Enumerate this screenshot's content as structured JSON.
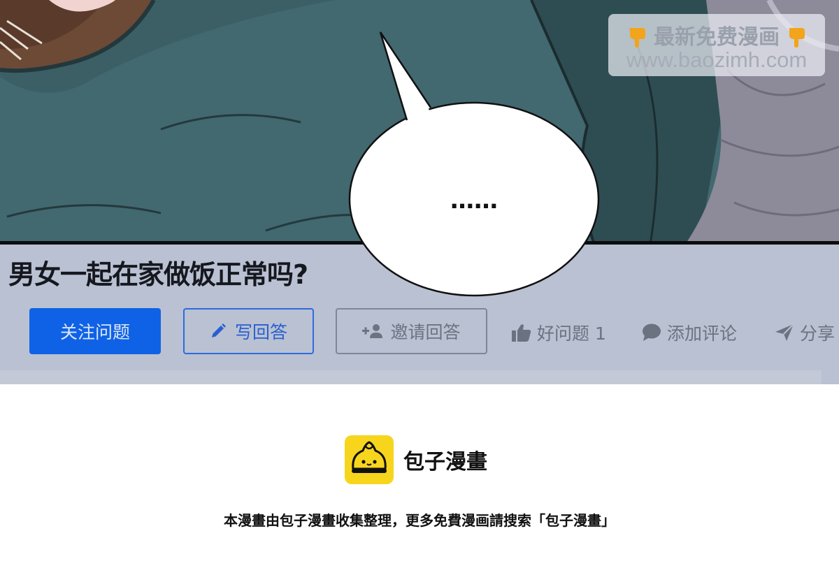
{
  "comic": {
    "speech_text": "……",
    "question_card": {
      "title": "男女一起在家做饭正常吗?",
      "follow_label": "关注问题",
      "write_answer_label": "写回答",
      "invite_label": "邀请回答",
      "good_question_label": "好问题 1",
      "add_comment_label": "添加评论",
      "share_label": "分享"
    },
    "watermark": {
      "line1": "最新免费漫画",
      "line2": "www.baozimh.com"
    }
  },
  "footer": {
    "brand_name": "包子漫畫",
    "note": "本漫畫由包子漫畫收集整理，更多免費漫画請搜索「包子漫畫」"
  },
  "colors": {
    "brand_yellow": "#f7d51d",
    "primary_blue": "#0f62e6",
    "card_background": "#b9c1d2",
    "panel_teal": "#3c5f66"
  },
  "icons": [
    "pencil-icon",
    "add-user-icon",
    "thumbs-up-icon",
    "comment-icon",
    "share-arrow-icon",
    "pointing-hand-icon",
    "bun-logo-icon"
  ]
}
